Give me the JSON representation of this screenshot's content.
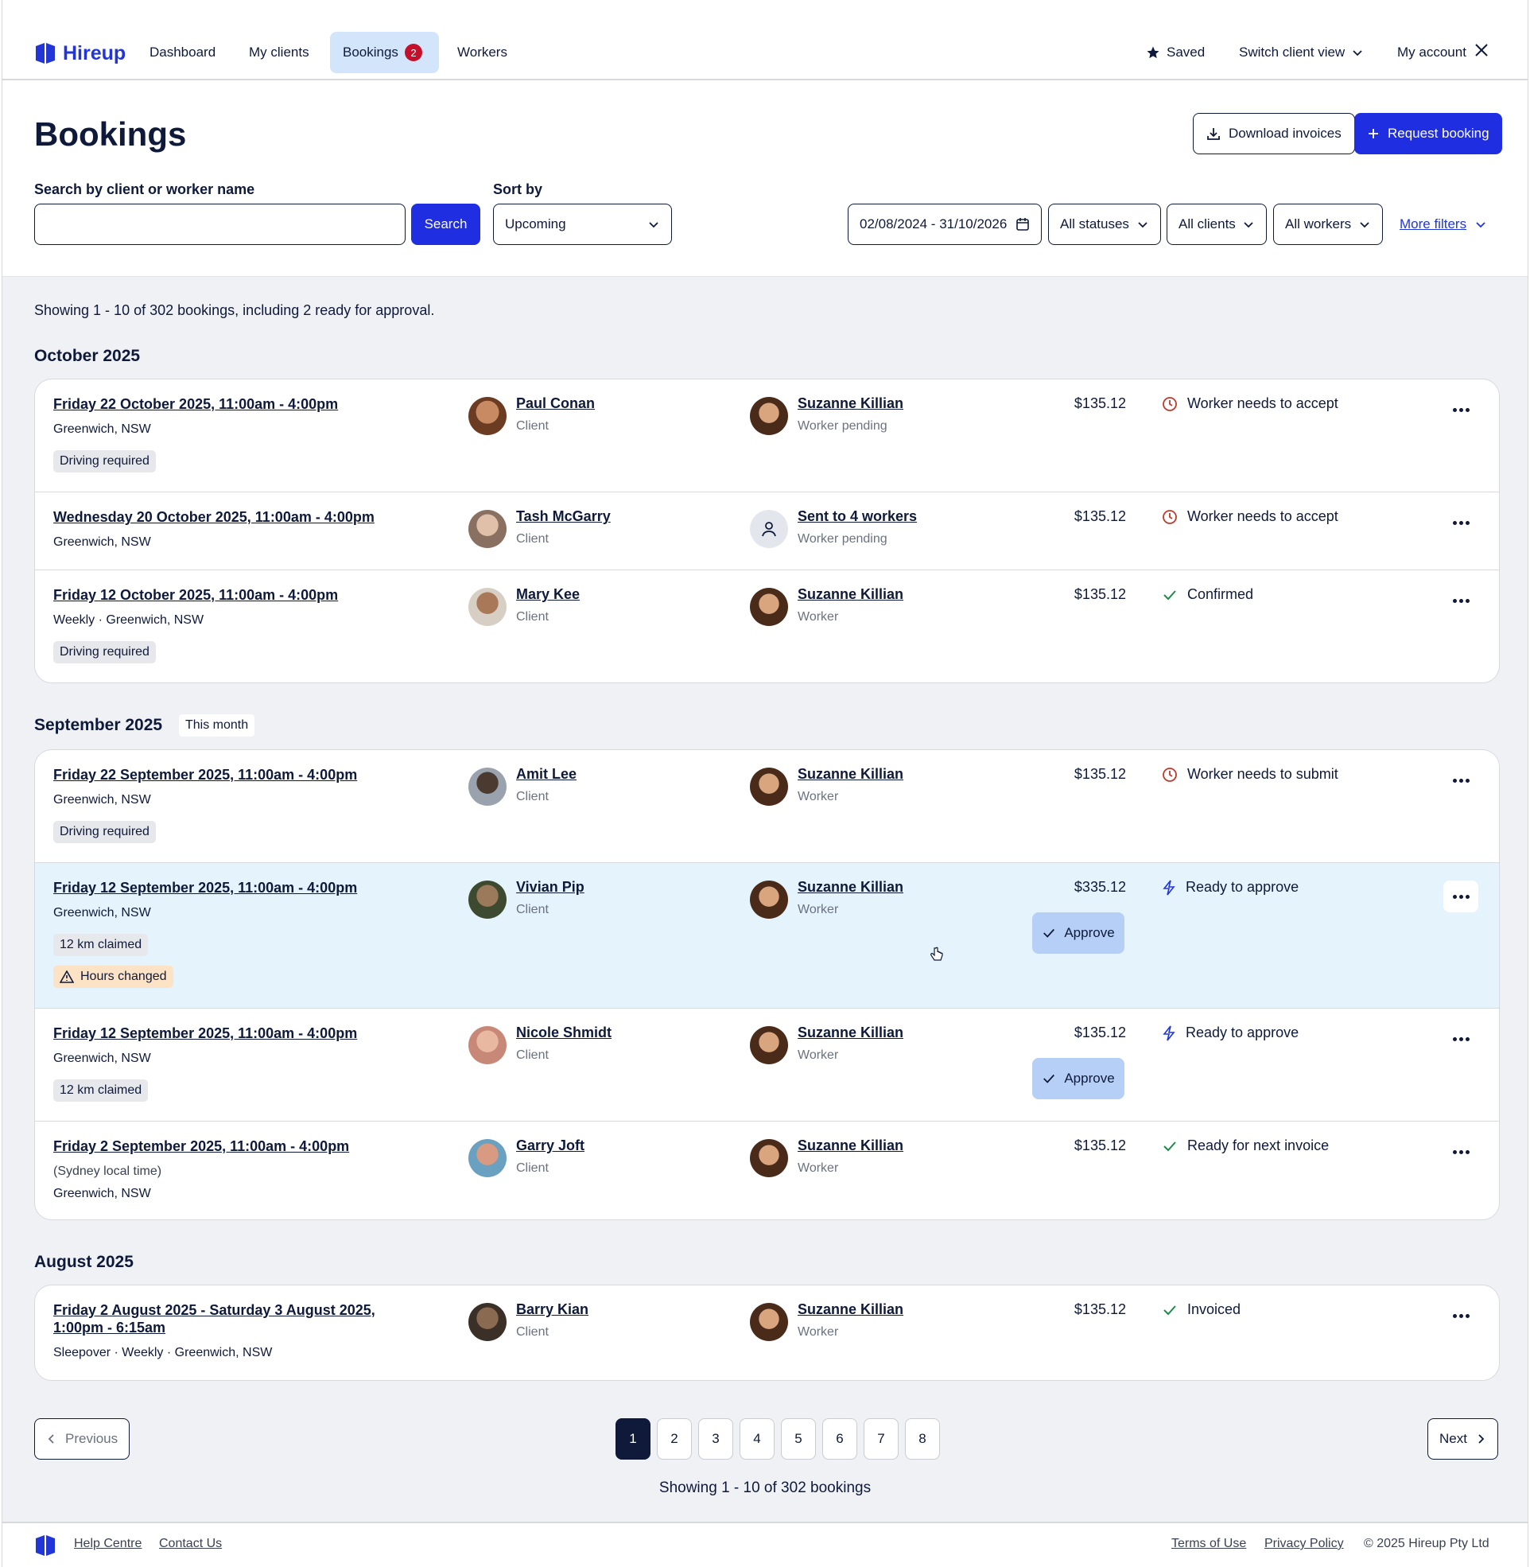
{
  "nav": {
    "brand": "Hireup",
    "links": [
      "Dashboard",
      "My clients",
      "Bookings",
      "Workers"
    ],
    "bookings_badge": "2",
    "saved": "Saved",
    "switch_view": "Switch client view",
    "account": "My account"
  },
  "page": {
    "title": "Bookings",
    "download_invoices": "Download invoices",
    "request_booking": "Request booking"
  },
  "filters": {
    "search_label": "Search by client or worker name",
    "search_value": "",
    "search_button": "Search",
    "sort_label": "Sort by",
    "sort_value": "Upcoming",
    "date_range": "02/08/2024 - 31/10/2026",
    "statuses": "All statuses",
    "clients": "All clients",
    "workers": "All workers",
    "more_filters": "More filters"
  },
  "summary": "Showing 1 - 10 of 302 bookings, including 2 ready for approval.",
  "groups": [
    {
      "month": "October 2025",
      "tag": "",
      "bookings": [
        {
          "date": "Friday 22 October 2025, 11:00am - 4:00pm",
          "location": "Greenwich, NSW",
          "tags": [
            "Driving required"
          ],
          "client": "Paul Conan",
          "client_role": "Client",
          "worker": "Suzanne Killian",
          "worker_role": "Worker pending",
          "price": "$135.12",
          "status": "Worker needs to accept",
          "status_icon": "clock-icon"
        },
        {
          "date": "Wednesday 20 October 2025, 11:00am - 4:00pm",
          "location": "Greenwich, NSW",
          "tags": [],
          "client": "Tash McGarry",
          "client_role": "Client",
          "worker": "Sent to 4 workers",
          "worker_role": "Worker pending",
          "price": "$135.12",
          "status": "Worker needs to accept",
          "status_icon": "clock-icon"
        },
        {
          "date": "Friday 12 October 2025, 11:00am - 4:00pm",
          "location": "Weekly · Greenwich, NSW",
          "tags": [
            "Driving required"
          ],
          "client": "Mary Kee",
          "client_role": "Client",
          "worker": "Suzanne Killian",
          "worker_role": "Worker",
          "price": "$135.12",
          "status": "Confirmed",
          "status_icon": "check-icon"
        }
      ]
    },
    {
      "month": "September 2025",
      "tag": "This month",
      "bookings": [
        {
          "date": "Friday 22 September 2025, 11:00am - 4:00pm",
          "location": "Greenwich, NSW",
          "tags": [
            "Driving required"
          ],
          "client": "Amit Lee",
          "client_role": "Client",
          "worker": "Suzanne Killian",
          "worker_role": "Worker",
          "price": "$135.12",
          "status": "Worker needs to submit",
          "status_icon": "clock-icon"
        },
        {
          "date": "Friday 12 September 2025, 11:00am - 4:00pm",
          "location": "Greenwich, NSW",
          "tags": [
            "12 km claimed"
          ],
          "warning": "Hours changed",
          "client": "Vivian Pip",
          "client_role": "Client",
          "worker": "Suzanne Killian",
          "worker_role": "Worker",
          "price": "$335.12",
          "status": "Ready to approve",
          "status_icon": "lightning-icon",
          "approve": "Approve"
        },
        {
          "date": "Friday 12 September 2025, 11:00am - 4:00pm",
          "location": "Greenwich, NSW",
          "tags": [
            "12 km claimed"
          ],
          "client": "Nicole Shmidt",
          "client_role": "Client",
          "worker": "Suzanne Killian",
          "worker_role": "Worker",
          "price": "$135.12",
          "status": "Ready to approve",
          "status_icon": "lightning-icon",
          "approve": "Approve"
        },
        {
          "date": "Friday 2 September 2025, 11:00am - 4:00pm",
          "subnote": "(Sydney local time)",
          "location": "Greenwich, NSW",
          "tags": [],
          "client": "Garry Joft",
          "client_role": "Client",
          "worker": "Suzanne Killian",
          "worker_role": "Worker",
          "price": "$135.12",
          "status": "Ready for next invoice",
          "status_icon": "check-icon"
        }
      ]
    },
    {
      "month": "August 2025",
      "tag": "",
      "bookings": [
        {
          "date": "Friday 2 August 2025 - Saturday 3 August 2025, 1:00pm - 6:15am",
          "location": "Sleepover · Weekly · Greenwich, NSW",
          "tags": [],
          "client": "Barry Kian",
          "client_role": "Client",
          "worker": "Suzanne Killian",
          "worker_role": "Worker",
          "price": "$135.12",
          "status": "Invoiced",
          "status_icon": "check-icon"
        }
      ]
    }
  ],
  "pagination": {
    "previous": "Previous",
    "next": "Next",
    "pages": [
      "1",
      "2",
      "3",
      "4",
      "5",
      "6",
      "7",
      "8"
    ],
    "current": "1",
    "summary": "Showing 1 - 10 of 302 bookings"
  },
  "footer": {
    "help": "Help Centre",
    "contact": "Contact Us",
    "terms": "Terms of Use",
    "privacy": "Privacy Policy",
    "copyright": "© 2025 Hireup Pty Ltd"
  },
  "colors": {
    "brand": "#2236d8",
    "primary": "#1f2ee0",
    "navy": "#0f1a3a",
    "clock": "#c0392b",
    "check": "#1e8a4a",
    "highlight_row": "#e4f3fc"
  }
}
